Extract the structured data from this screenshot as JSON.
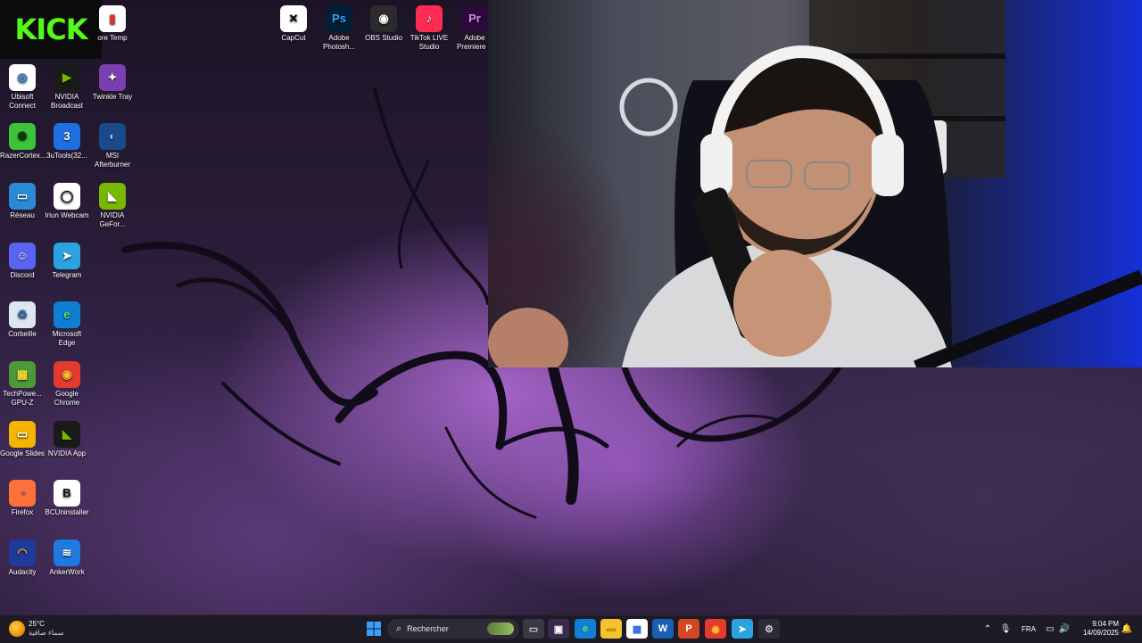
{
  "desktop": {
    "kick_logo": "KICK",
    "icons": [
      {
        "label": "Core Temp",
        "display": "ore Temp",
        "glyph": "▮",
        "color": "#ffffff",
        "fg": "#d33"
      },
      {
        "label": "CapCut",
        "glyph": "✕",
        "color": "#ffffff",
        "fg": "#000"
      },
      {
        "label": "Adobe Photosh...",
        "glyph": "Ps",
        "color": "#001e36",
        "fg": "#31a8ff"
      },
      {
        "label": "OBS Studio",
        "glyph": "◉",
        "color": "#2b2b2b",
        "fg": "#ffffff"
      },
      {
        "label": "TikTok LIVE Studio",
        "glyph": "♪",
        "color": "#fe2c55",
        "fg": "#ffffff"
      },
      {
        "label": "Adobe Premiere P",
        "glyph": "Pr",
        "color": "#2a0a3a",
        "fg": "#e08bff"
      },
      {
        "label": "Ubisoft Connect",
        "glyph": "◎",
        "color": "#ffffff",
        "fg": "#1b6fd6"
      },
      {
        "label": "NVIDIA Broadcast",
        "glyph": "▶",
        "color": "#1a1a1a",
        "fg": "#76b900"
      },
      {
        "label": "Twinkle Tray",
        "glyph": "✦",
        "color": "#7b3fb0",
        "fg": "#ffffff"
      },
      {
        "label": "RazerCortex...",
        "glyph": "✺",
        "color": "#3ec43a",
        "fg": "#0a3a0a"
      },
      {
        "label": "3uTools(32...",
        "glyph": "3",
        "color": "#1e6fe0",
        "fg": "#ffffff"
      },
      {
        "label": "MSI Afterburner",
        "glyph": "◐",
        "color": "#1a4a8a",
        "fg": "#7fd1ff"
      },
      {
        "label": "Réseau",
        "glyph": "▭",
        "color": "#2a8ad6",
        "fg": "#ffffff"
      },
      {
        "label": "Iriun Webcam",
        "glyph": "◯",
        "color": "#ffffff",
        "fg": "#111"
      },
      {
        "label": "NVIDIA GeFor...",
        "glyph": "◣",
        "color": "#76b900",
        "fg": "#ffffff"
      },
      {
        "label": "Discord",
        "glyph": "☺",
        "color": "#5865f2",
        "fg": "#ffffff"
      },
      {
        "label": "Telegram",
        "glyph": "➤",
        "color": "#2aa3e0",
        "fg": "#ffffff"
      },
      {
        "label": "Corbeille",
        "glyph": "♻",
        "color": "#dde6f0",
        "fg": "#2a6ab0"
      },
      {
        "label": "Microsoft Edge",
        "glyph": "e",
        "color": "#0f7fd4",
        "fg": "#6ee06a"
      },
      {
        "label": "TechPowe... GPU-Z",
        "glyph": "▦",
        "color": "#4a9a3a",
        "fg": "#ffdd33"
      },
      {
        "label": "Google Chrome",
        "glyph": "◉",
        "color": "#e33b2e",
        "fg": "#fbc02d"
      },
      {
        "label": "Google Slides",
        "glyph": "▭",
        "color": "#f4b400",
        "fg": "#ffffff"
      },
      {
        "label": "NVIDIA App",
        "glyph": "◣",
        "color": "#1a1a1a",
        "fg": "#76b900"
      },
      {
        "label": "Firefox",
        "glyph": "◔",
        "color": "#ff7139",
        "fg": "#9059ff"
      },
      {
        "label": "BCUninstaller",
        "glyph": "B",
        "color": "#ffffff",
        "fg": "#111"
      },
      {
        "label": "Audacity",
        "glyph": "◠",
        "color": "#1e3a9a",
        "fg": "#ffb000"
      },
      {
        "label": "AnkerWork",
        "glyph": "≋",
        "color": "#1f7ae0",
        "fg": "#ffffff"
      }
    ]
  },
  "taskbar": {
    "weather_temp": "25°C",
    "weather_desc": "سماء صافية",
    "search_placeholder": "Rechercher",
    "apps": [
      {
        "name": "task-view",
        "glyph": "▭",
        "color": "#3a3a46",
        "fg": "#cfcfd8"
      },
      {
        "name": "capture-tool",
        "glyph": "▣",
        "color": "#3a2a50",
        "fg": "#ffffff"
      },
      {
        "name": "edge",
        "glyph": "e",
        "color": "#0f7fd4",
        "fg": "#6ee06a"
      },
      {
        "name": "file-explorer",
        "glyph": "▬",
        "color": "#f2c230",
        "fg": "#c78f00"
      },
      {
        "name": "ms-store",
        "glyph": "▦",
        "color": "#ffffff",
        "fg": "#2a6ad6"
      },
      {
        "name": "word",
        "glyph": "W",
        "color": "#1a5fb4",
        "fg": "#ffffff"
      },
      {
        "name": "powerpoint",
        "glyph": "P",
        "color": "#d24726",
        "fg": "#ffffff"
      },
      {
        "name": "chrome",
        "glyph": "◉",
        "color": "#e33b2e",
        "fg": "#fbc02d"
      },
      {
        "name": "telegram",
        "glyph": "➤",
        "color": "#2aa3e0",
        "fg": "#ffffff"
      },
      {
        "name": "settings",
        "glyph": "⚙",
        "color": "#2e2a38",
        "fg": "#cfcfd8"
      }
    ],
    "language": "FRA",
    "time": "9:04 PM",
    "date": "14/09/2025"
  }
}
